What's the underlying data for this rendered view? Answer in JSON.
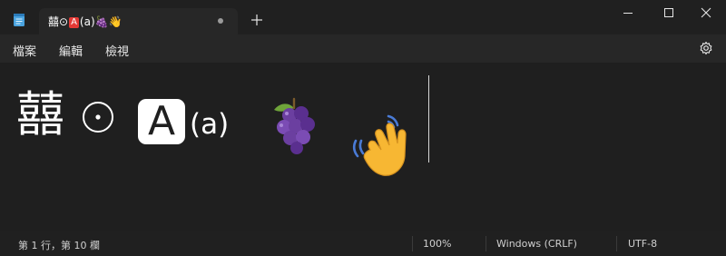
{
  "window": {
    "tab_title_prefix": "囍⊙",
    "tab_title_box": "A",
    "tab_title_suffix": "(a)🍇👋"
  },
  "menu": {
    "items": [
      "檔案",
      "編輯",
      "檢視"
    ]
  },
  "editor": {
    "main_glyph": "囍",
    "boxed_letter": "A",
    "parenthesized": "(a)",
    "emoji_names": [
      "grapes",
      "waving-hand"
    ]
  },
  "status": {
    "position": "第 1 行，第 10 欄",
    "zoom": "100%",
    "line_ending": "Windows (CRLF)",
    "encoding": "UTF-8"
  },
  "colors": {
    "background": "#1f1f1f",
    "accent_red": "#e53935"
  },
  "icons": [
    "notepad-icon",
    "close-tab-dot-icon",
    "plus-icon",
    "minimize-icon",
    "maximize-icon",
    "close-icon",
    "gear-icon"
  ]
}
